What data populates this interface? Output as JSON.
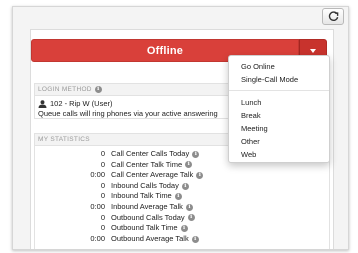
{
  "status": {
    "label": "Offline",
    "color": "#d9403a"
  },
  "login": {
    "heading": "LOGIN METHOD",
    "user": "102 - Rip W (User)",
    "note": "Queue calls will ring phones via your active answering"
  },
  "stats": {
    "heading": "MY STATISTICS",
    "rows": [
      {
        "value": "0",
        "label": "Call Center Calls Today"
      },
      {
        "value": "0",
        "label": "Call Center Talk Time"
      },
      {
        "value": "0:00",
        "label": "Call Center Average Talk"
      },
      {
        "value": "0",
        "label": "Inbound Calls Today"
      },
      {
        "value": "0",
        "label": "Inbound Talk Time"
      },
      {
        "value": "0:00",
        "label": "Inbound Average Talk"
      },
      {
        "value": "0",
        "label": "Outbound Calls Today"
      },
      {
        "value": "0",
        "label": "Outbound Talk Time"
      },
      {
        "value": "0:00",
        "label": "Outbound Average Talk"
      }
    ]
  },
  "menu": {
    "primary": [
      "Go Online",
      "Single-Call Mode"
    ],
    "reasons": [
      "Lunch",
      "Break",
      "Meeting",
      "Other",
      "Web"
    ]
  },
  "icons": {
    "refresh": "refresh-icon",
    "caret": "caret-down-icon",
    "user": "user-icon",
    "info": "info-icon"
  }
}
